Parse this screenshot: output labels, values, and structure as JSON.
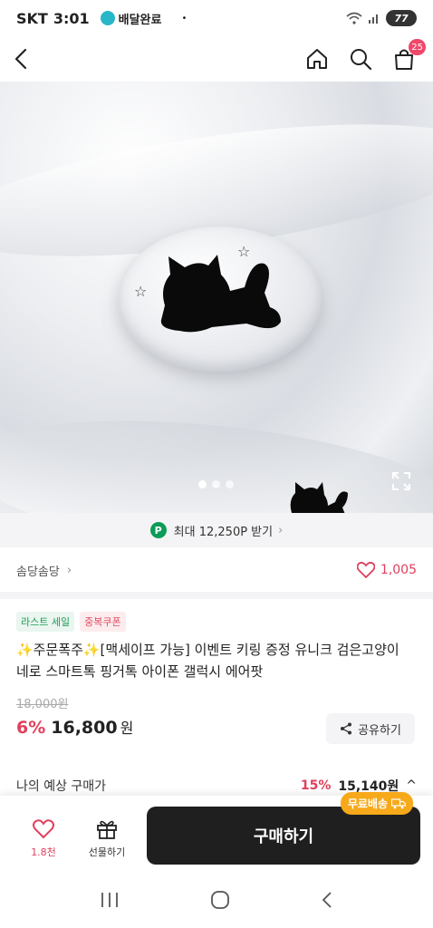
{
  "status_bar": {
    "carrier": "SKT",
    "time": "3:01",
    "delivery_label": "배달완료",
    "separator": "•",
    "battery": "77"
  },
  "header": {
    "cart_count": "25",
    "icons": [
      "back-icon",
      "home-icon",
      "search-icon",
      "cart-icon"
    ]
  },
  "gallery": {
    "total_images": 3,
    "active_index": 0
  },
  "point_bar": {
    "icon_letter": "P",
    "text": "최대 12,250P 받기",
    "chevron": "›"
  },
  "store": {
    "name": "솜당솜당",
    "chevron": "›",
    "likes": "1,005"
  },
  "product": {
    "badges": [
      "라스트 세일",
      "중복쿠폰"
    ],
    "title": "✨주문폭주✨[맥세이프 가능] 이벤트 키링 증정 유니크 검은고양이 네로 스마트톡 핑거톡 아이폰 갤럭시 에어팟",
    "original_price": "18,000원",
    "discount": "6%",
    "price": "16,800",
    "currency": "원",
    "share_label": "공유하기"
  },
  "expected_price": {
    "label": "나의 예상 구매가",
    "discount": "15%",
    "value": "15,140원",
    "chevron": "^"
  },
  "bottom_bar": {
    "wish_count": "1.8천",
    "gift_label": "선물하기",
    "buy_label": "구매하기",
    "free_shipping": "무료배송"
  },
  "colors": {
    "accent_red": "#e0405c",
    "point_green": "#0c9c58",
    "buy_button": "#1f1f1f",
    "free_ship": "#f7a91a"
  }
}
